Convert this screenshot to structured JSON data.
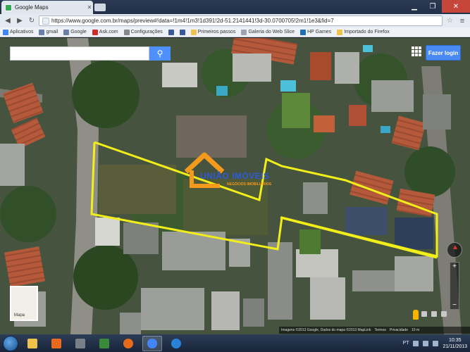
{
  "browser": {
    "tab_title": "Google Maps",
    "url": "https://www.google.com.br/maps/preview#!data=!1m4!1m3!1d391!2d-51.2141441!3d-30.0700705!2m1!1e3&fid=7"
  },
  "bookmarks": [
    {
      "label": "Aplicativos",
      "color": "#4285f4",
      "icon": "apps-icon"
    },
    {
      "label": "gmail",
      "color": "#6b7fa8",
      "icon": "gmail-icon"
    },
    {
      "label": "Google",
      "color": "#6b7fa8",
      "icon": "google-icon"
    },
    {
      "label": "Ask.com",
      "color": "#d02b2b",
      "icon": "ask-icon"
    },
    {
      "label": "Configurações",
      "color": "#888888",
      "icon": "wrench-icon"
    },
    {
      "label": "",
      "color": "#3b5998",
      "icon": "facebook-icon"
    },
    {
      "label": "",
      "color": "#3b5998",
      "icon": "facebook-icon"
    },
    {
      "label": "Primeiros passos",
      "color": "#f0c14b",
      "icon": "folder-icon"
    },
    {
      "label": "Galeria do Web Slice",
      "color": "#9aa5b1",
      "icon": "page-icon"
    },
    {
      "label": "HP Games",
      "color": "#1f6fb5",
      "icon": "hp-icon"
    },
    {
      "label": "Importado do Firefox",
      "color": "#f0c14b",
      "icon": "folder-icon"
    }
  ],
  "map": {
    "login_label": "Fazer login",
    "thumb_label": "Mapa",
    "attribution": [
      "Imagens ©2013 Google, Dados do mapa ©2013 MapLink",
      "Termos",
      "Privacidade",
      "10 m"
    ],
    "watermark": {
      "title": "UNIÃO IMÓVEIS",
      "subtitle": "NEGÓCIOS IMOBILIÁRIOS"
    }
  },
  "taskbar": {
    "apps": [
      {
        "name": "taskbar-explorer",
        "color": "#f0c14b"
      },
      {
        "name": "taskbar-media",
        "color": "#e96a1a"
      },
      {
        "name": "taskbar-printer",
        "color": "#7a7f86"
      },
      {
        "name": "taskbar-app",
        "color": "#3a8a3a"
      },
      {
        "name": "taskbar-firefox",
        "color": "#e66a1a"
      },
      {
        "name": "taskbar-chrome",
        "color": "#4285f4"
      },
      {
        "name": "taskbar-ie",
        "color": "#2a82d8"
      }
    ],
    "lang": "PT",
    "time": "10:35",
    "date": "21/11/2013"
  }
}
